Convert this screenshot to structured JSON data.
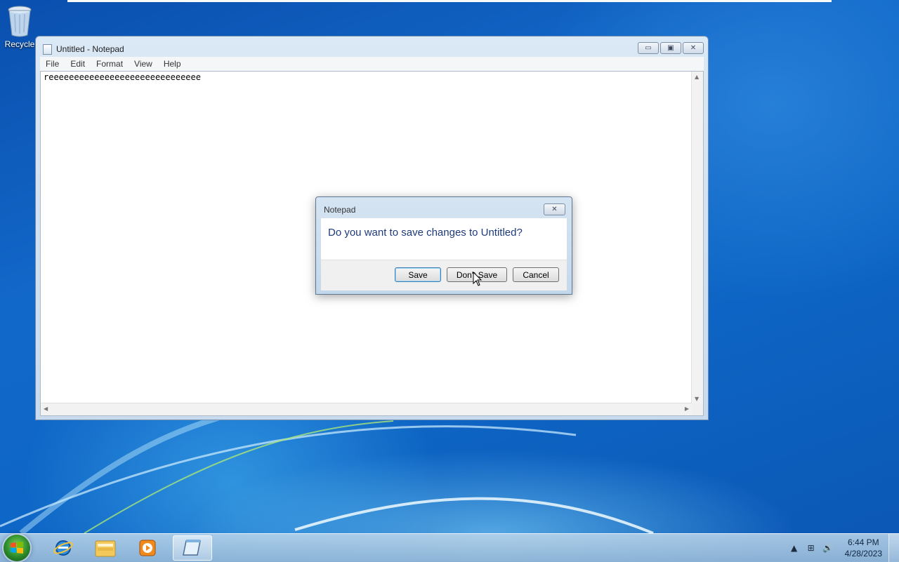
{
  "desktop": {
    "icons": [
      {
        "label": "Recycle",
        "icon": "recycle-bin-icon"
      }
    ]
  },
  "notepad": {
    "title": "Untitled - Notepad",
    "menu": [
      "File",
      "Edit",
      "Format",
      "View",
      "Help"
    ],
    "content": "reeeeeeeeeeeeeeeeeeeeeeeeeeeeee",
    "caption_buttons": {
      "minimize": "▭",
      "maximize": "▣",
      "close": "✕"
    }
  },
  "dialog": {
    "title": "Notepad",
    "message": "Do you want to save changes to Untitled?",
    "close_glyph": "✕",
    "buttons": {
      "save": "Save",
      "dont_save": "Don't Save",
      "cancel": "Cancel"
    }
  },
  "taskbar": {
    "pinned": [
      "internet-explorer-icon",
      "windows-explorer-icon",
      "media-player-icon",
      "notepad-icon"
    ],
    "active": "notepad-icon",
    "tray": {
      "show_hidden": "▲",
      "network": "⊞",
      "volume": "🔊"
    },
    "clock": {
      "time": "6:44 PM",
      "date": "4/28/2023"
    }
  },
  "colors": {
    "accent": "#3c7fb1",
    "dialog_text": "#1e3a7a",
    "start_orb": "#2b8a2a"
  }
}
